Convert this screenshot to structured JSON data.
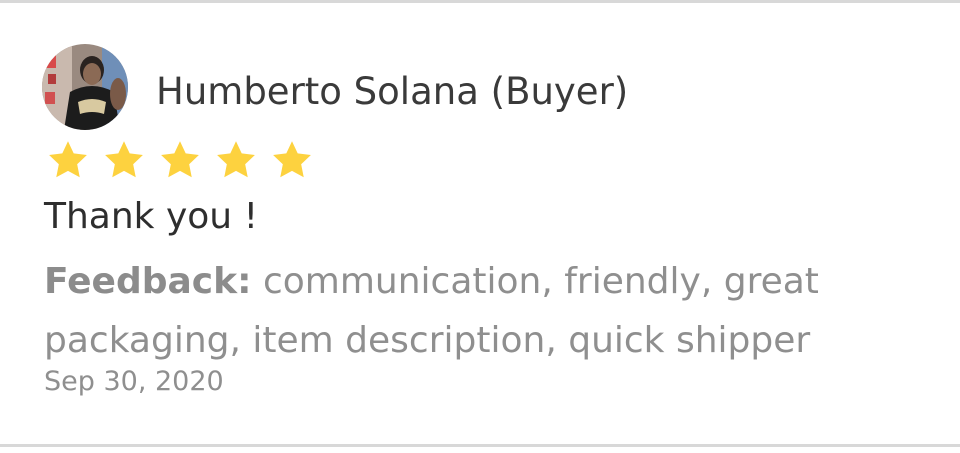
{
  "review": {
    "reviewer_name": "Humberto Solana (Buyer)",
    "rating": 5,
    "rating_max": 5,
    "star_color": "#fdd23f",
    "text": "Thank you !",
    "feedback_label": "Feedback:",
    "feedback_items": "communication, friendly, great packaging, item description, quick shipper",
    "date": "Sep 30, 2020"
  },
  "icons": {
    "avatar": "user-photo-avatar",
    "star": "star-icon"
  }
}
